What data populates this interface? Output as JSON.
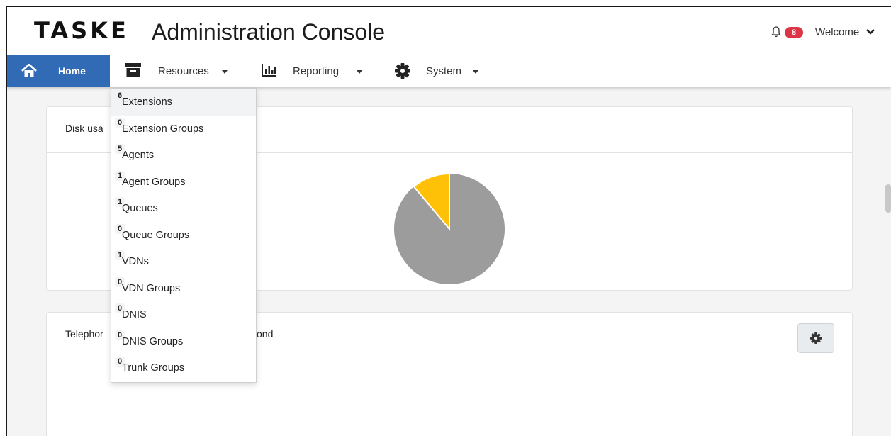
{
  "header": {
    "logo_text": "TASKE",
    "title": "Administration Console",
    "notifications_count": "8",
    "welcome_label": "Welcome"
  },
  "nav": {
    "home": "Home",
    "resources": "Resources",
    "reporting": "Reporting",
    "system": "System"
  },
  "resources_menu": {
    "items": [
      {
        "label": "Extensions",
        "count": "6"
      },
      {
        "label": "Extension Groups",
        "count": "0"
      },
      {
        "label": "Agents",
        "count": "5"
      },
      {
        "label": "Agent Groups",
        "count": "1"
      },
      {
        "label": "Queues",
        "count": "1"
      },
      {
        "label": "Queue Groups",
        "count": "0"
      },
      {
        "label": "VDNs",
        "count": "1"
      },
      {
        "label": "VDN Groups",
        "count": "0"
      },
      {
        "label": "DNIS",
        "count": "0"
      },
      {
        "label": "DNIS Groups",
        "count": "0"
      },
      {
        "label": "Trunk Groups",
        "count": "0"
      }
    ]
  },
  "cards": {
    "disk_usage_title_visible": "Disk usa",
    "telephony_title_left_visible": "Telephor",
    "telephony_title_right_visible": "ond"
  },
  "colors": {
    "nav_home_bg": "#316ab5",
    "badge_bg": "#dc3545",
    "pie_used": "#9c9c9c",
    "pie_free": "#ffc107"
  },
  "icons": [
    "bell-icon",
    "chevron-down-icon",
    "home-icon",
    "archive-icon",
    "bar-chart-icon",
    "gear-icon"
  ]
}
